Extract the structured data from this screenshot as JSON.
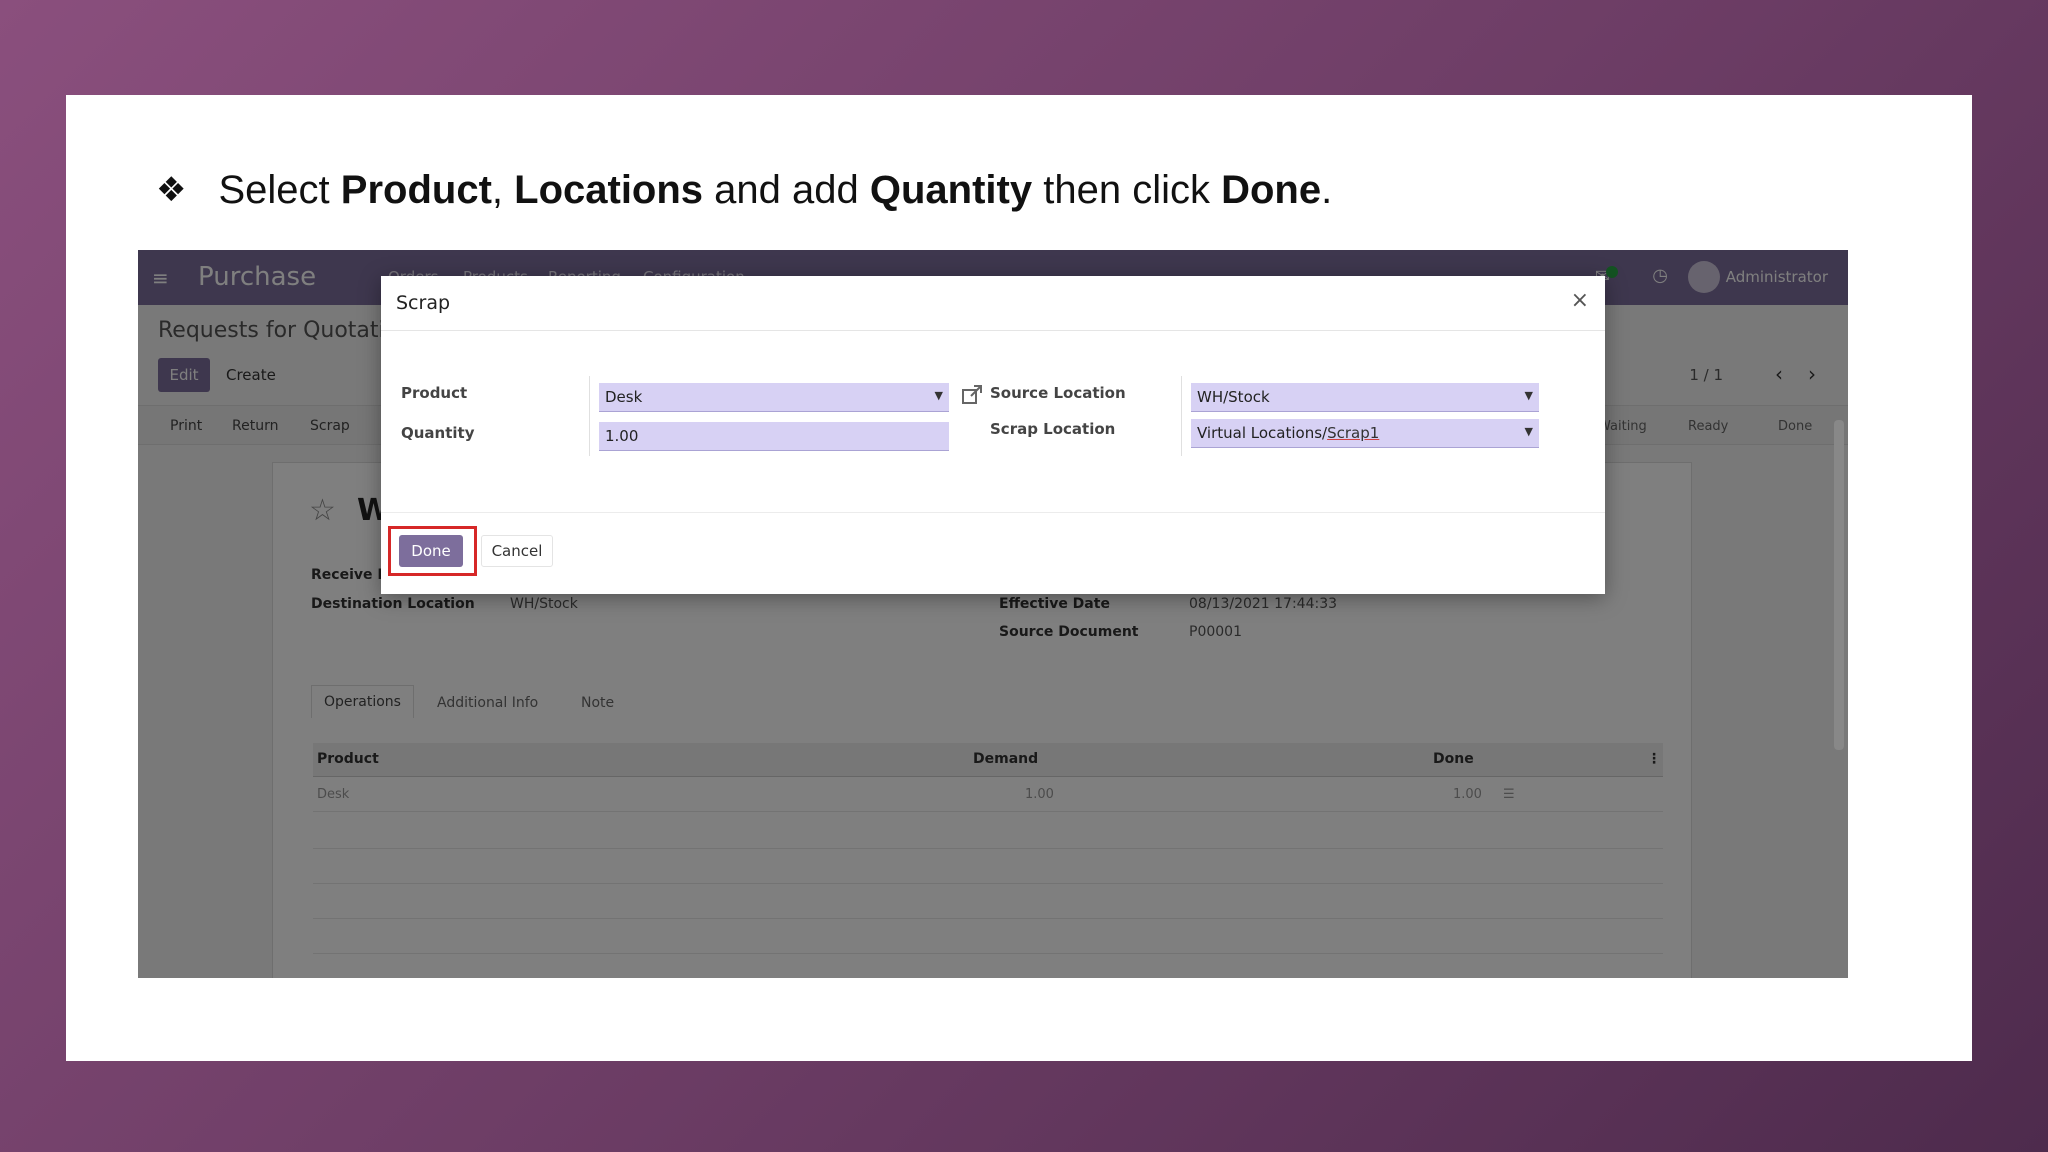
{
  "instruction": {
    "bullet": "❖",
    "t1": "Select ",
    "b1": "Product",
    "t2": ", ",
    "b2": "Locations",
    "t3": " and add ",
    "b3": "Quantity",
    "t4": " then click ",
    "b4": "Done",
    "t5": "."
  },
  "app": {
    "apps_icon": "≡",
    "brand": "Purchase",
    "menu": [
      "Orders",
      "Products",
      "Reporting",
      "Configuration"
    ],
    "user": "Administrator"
  },
  "control_panel": {
    "title": "Requests for Quotation",
    "edit": "Edit",
    "create": "Create",
    "pager": "1 / 1",
    "actions": [
      "Print",
      "Return",
      "Scrap"
    ],
    "statuses": [
      "Waiting",
      "Ready",
      "Done"
    ]
  },
  "record": {
    "title": "W",
    "receive_from_label": "Receive From",
    "destination_label": "Destination Location",
    "destination_value": "WH/Stock",
    "effective_date_label": "Effective Date",
    "effective_date_value": "08/13/2021 17:44:33",
    "source_doc_label": "Source Document",
    "source_doc_value": "P00001",
    "tabs": [
      "Operations",
      "Additional Info",
      "Note"
    ],
    "columns": {
      "product": "Product",
      "demand": "Demand",
      "done": "Done"
    },
    "line": {
      "product": "Desk",
      "demand": "1.00",
      "done": "1.00"
    }
  },
  "modal": {
    "title": "Scrap",
    "product_label": "Product",
    "product_value": "Desk",
    "quantity_label": "Quantity",
    "quantity_value": "1.00",
    "source_location_label": "Source Location",
    "source_location_value": "WH/Stock",
    "scrap_location_label": "Scrap Location",
    "scrap_location_prefix": "Virtual Locations/",
    "scrap_location_suffix": "Scrap1",
    "done": "Done",
    "cancel": "Cancel"
  },
  "colors": {
    "brand": "#7d6e9c",
    "field_bg": "#d7d1f4",
    "highlight": "#d62828"
  }
}
